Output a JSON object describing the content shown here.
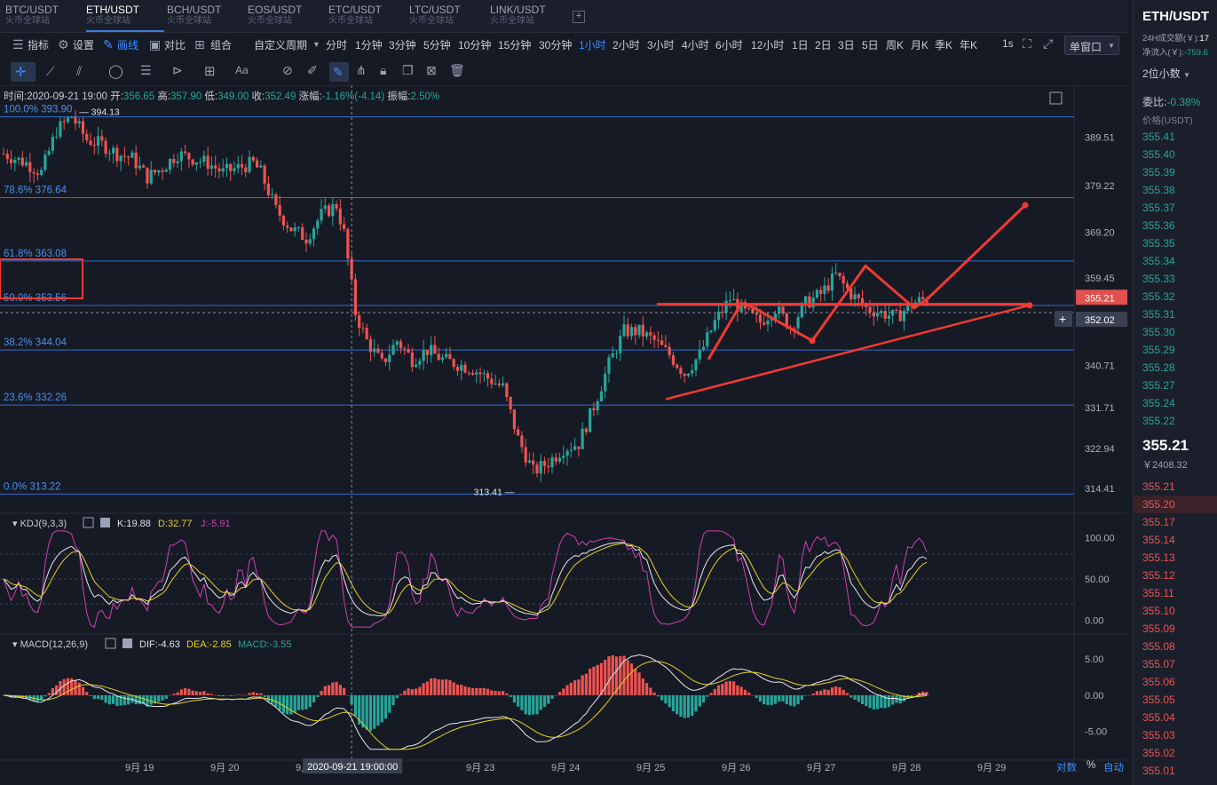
{
  "tabs": [
    {
      "label": "BTC/USDT",
      "sub": "火币全球站"
    },
    {
      "label": "ETH/USDT",
      "sub": "火币全球站",
      "active": true
    },
    {
      "label": "BCH/USDT",
      "sub": "火币全球站"
    },
    {
      "label": "EOS/USDT",
      "sub": "火币全球站"
    },
    {
      "label": "ETC/USDT",
      "sub": "火币全球站"
    },
    {
      "label": "LTC/USDT",
      "sub": "火币全球站"
    },
    {
      "label": "LINK/USDT",
      "sub": "火币全球站"
    }
  ],
  "add_tab": "+",
  "toolbar": {
    "indicators": "指标",
    "settings": "设置",
    "draw": "画线",
    "compare": "对比",
    "combine": "组合",
    "custom_period": "自定义周期",
    "periods": [
      "分时",
      "1分钟",
      "3分钟",
      "5分钟",
      "10分钟",
      "15分钟",
      "30分钟",
      "1小时",
      "2小时",
      "3小时",
      "4小时",
      "6小时",
      "12小时",
      "1日",
      "2日",
      "3日",
      "5日",
      "周K",
      "月K",
      "季K",
      "年K"
    ],
    "active_period": "1小时",
    "seconds": "1s",
    "window_mode": "单窗口"
  },
  "info": {
    "time_label": "时间:",
    "time": "2020-09-21 19:00",
    "open_label": "开:",
    "open": "356.65",
    "high_label": "高:",
    "high": "357.90",
    "low_label": "低:",
    "low": "349.00",
    "close_label": "收:",
    "close": "352.49",
    "change_label": "涨幅:",
    "change": "-1.16%(-4.14)",
    "amp_label": "振幅:",
    "amp": "2.50%"
  },
  "colors": {
    "up": "#26a69a",
    "down": "#ef5350",
    "bg": "#161a25",
    "accent": "#3b8cff",
    "fib": "#2f6fd1",
    "annotation": "#f03a33"
  },
  "chart_data": [
    {
      "type": "candlestick",
      "title": "ETH/USDT 1小时",
      "x_ticks": [
        "9月 19",
        "9月 20",
        "9月 21",
        "9月 23",
        "9月 24",
        "9月 25",
        "9月 26",
        "9月 27",
        "9月 28",
        "9月 29"
      ],
      "y_ticks": [
        389.51,
        379.22,
        369.2,
        359.45,
        349.95,
        340.71,
        331.71,
        322.94,
        314.41
      ],
      "ylim": [
        311,
        398
      ],
      "last_price": "355.21",
      "cursor_price": "352.02",
      "crosshair_time": "2020-09-21 19:00:00",
      "high_mark": "394.13",
      "low_mark": "313.41",
      "close_path": [
        [
          0,
          386
        ],
        [
          6,
          384
        ],
        [
          10,
          382
        ],
        [
          14,
          391
        ],
        [
          18,
          394
        ],
        [
          22,
          389
        ],
        [
          26,
          388
        ],
        [
          30,
          386
        ],
        [
          34,
          385
        ],
        [
          38,
          381
        ],
        [
          42,
          383
        ],
        [
          46,
          386
        ],
        [
          50,
          385
        ],
        [
          54,
          384
        ],
        [
          58,
          382
        ],
        [
          62,
          383
        ],
        [
          66,
          384
        ],
        [
          68,
          382
        ],
        [
          72,
          374
        ],
        [
          76,
          370
        ],
        [
          80,
          368
        ],
        [
          84,
          373
        ],
        [
          88,
          375
        ],
        [
          90,
          369
        ],
        [
          93,
          352
        ],
        [
          96,
          346
        ],
        [
          100,
          341
        ],
        [
          104,
          346
        ],
        [
          108,
          342
        ],
        [
          112,
          344
        ],
        [
          116,
          342
        ],
        [
          120,
          341
        ],
        [
          124,
          340
        ],
        [
          128,
          338
        ],
        [
          132,
          336
        ],
        [
          136,
          325
        ],
        [
          140,
          318
        ],
        [
          144,
          320
        ],
        [
          148,
          323
        ],
        [
          152,
          324
        ],
        [
          156,
          332
        ],
        [
          160,
          341
        ],
        [
          164,
          348
        ],
        [
          168,
          348
        ],
        [
          172,
          346
        ],
        [
          176,
          343
        ],
        [
          180,
          339
        ],
        [
          184,
          343
        ],
        [
          188,
          350
        ],
        [
          192,
          355
        ],
        [
          196,
          352
        ],
        [
          200,
          350
        ],
        [
          204,
          353
        ],
        [
          208,
          349
        ],
        [
          212,
          354
        ],
        [
          216,
          356
        ],
        [
          220,
          360
        ],
        [
          224,
          356
        ],
        [
          228,
          353
        ],
        [
          232,
          352
        ],
        [
          236,
          351
        ],
        [
          240,
          354
        ],
        [
          244,
          355
        ]
      ],
      "fib_levels": [
        {
          "label": "100.0% 393.90",
          "value": 393.9
        },
        {
          "label": "78.6% 376.64",
          "value": 376.64
        },
        {
          "label": "61.8% 363.08",
          "value": 363.08
        },
        {
          "label": "50.0% 353.56",
          "value": 353.56
        },
        {
          "label": "38.2% 344.04",
          "value": 344.04
        },
        {
          "label": "23.6% 332.26",
          "value": 332.26
        },
        {
          "label": "0.0% 313.22",
          "value": 313.22
        }
      ]
    },
    {
      "type": "line",
      "name": "KDJ(9,3,3)",
      "values_text": {
        "K": "K:19.88",
        "D": "D:32.77",
        "J": "J:-5.91"
      },
      "y_ticks": [
        100.0,
        50.0,
        0.0
      ],
      "ylim": [
        -10,
        110
      ]
    },
    {
      "type": "bar",
      "name": "MACD(12,26,9)",
      "values_text": {
        "DIF": "DIF:-4.63",
        "DEA": "DEA:-2.85",
        "MACD": "MACD:-3.55"
      },
      "y_ticks": [
        5.0,
        0.0,
        -5.0
      ],
      "ylim": [
        -8,
        6.5
      ]
    }
  ],
  "bottom_bar": {
    "log": "对数",
    "pct": "%",
    "auto": "自动"
  },
  "right_panel": {
    "pair": "ETH/USDT",
    "vol_label": "24H成交额(￥):",
    "vol": "17",
    "net_label": "净流入(￥):",
    "net": "-759.6",
    "decimals": "2位小数",
    "ratio_label": "委比:",
    "ratio": "-0.38%",
    "price_col": "价格(USDT)",
    "asks": [
      "355.41",
      "355.40",
      "355.39",
      "355.38",
      "355.37",
      "355.36",
      "355.35",
      "355.34",
      "355.33",
      "355.32",
      "355.31",
      "355.30",
      "355.29",
      "355.28",
      "355.27",
      "355.24",
      "355.22"
    ],
    "last": "355.21",
    "last_cny": "￥2408.32",
    "bids": [
      "355.21",
      "355.20",
      "355.17",
      "355.14",
      "355.13",
      "355.12",
      "355.11",
      "355.10",
      "355.09",
      "355.08",
      "355.07",
      "355.06",
      "355.05",
      "355.04",
      "355.03",
      "355.02",
      "355.01"
    ]
  }
}
